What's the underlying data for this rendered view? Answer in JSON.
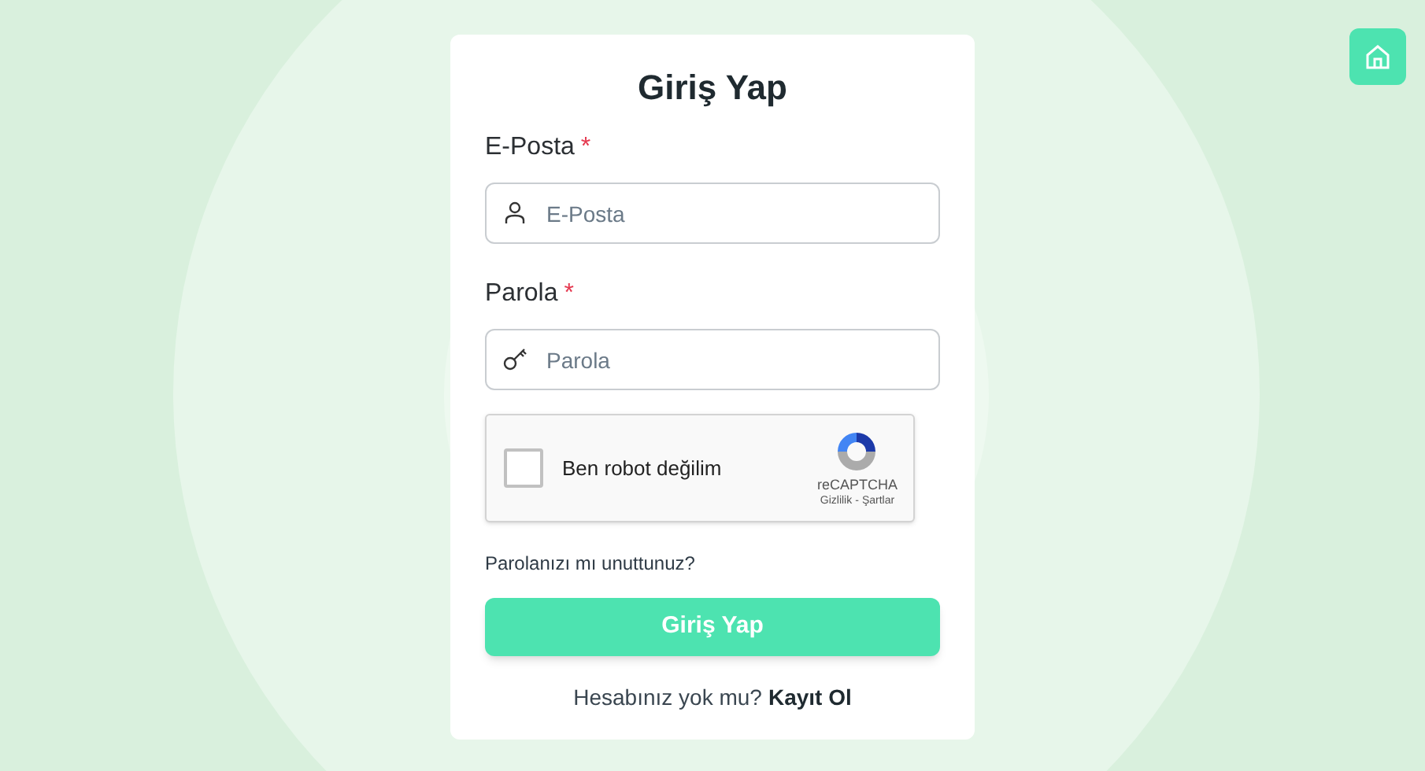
{
  "title": "Giriş Yap",
  "fields": [
    {
      "label": "E-Posta",
      "required": true,
      "required_mark": "*",
      "kind": "email",
      "placeholder": "E-Posta"
    },
    {
      "label": "Parola",
      "required": true,
      "required_mark": "*",
      "kind": "password",
      "placeholder": "Parola"
    }
  ],
  "captcha": {
    "label": "Ben robot değilim",
    "checked": false,
    "brand": "reCAPTCHA",
    "privacy": "Gizlilik",
    "separator": "-",
    "terms": "Şartlar"
  },
  "forgot_link": "Parolanızı mı unuttunuz?",
  "submit_button": "Giriş Yap",
  "footer": {
    "text": "Hesabınız yok mu?",
    "link": "Kayıt Ol"
  }
}
